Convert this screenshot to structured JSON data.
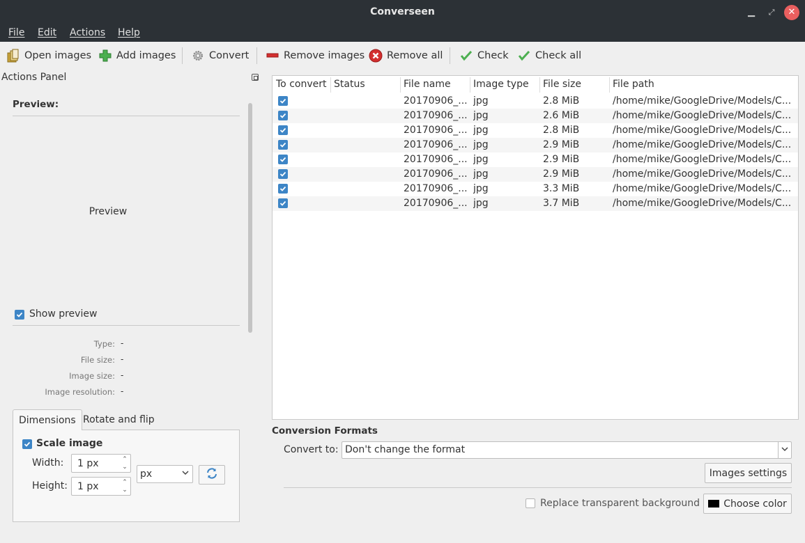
{
  "window": {
    "title": "Converseen"
  },
  "menu": [
    "File",
    "Edit",
    "Actions",
    "Help"
  ],
  "toolbar": {
    "open_images": "Open images",
    "add_images": "Add images",
    "convert": "Convert",
    "remove_images": "Remove images",
    "remove_all": "Remove all",
    "check": "Check",
    "check_all": "Check all"
  },
  "actions_panel": {
    "title": "Actions Panel",
    "preview_heading": "Preview:",
    "preview_placeholder": "Preview",
    "show_preview": {
      "label": "Show preview",
      "checked": true
    },
    "info": {
      "type_label": "Type:",
      "type_value": "-",
      "file_size_label": "File size:",
      "file_size_value": "-",
      "image_size_label": "Image size:",
      "image_size_value": "-",
      "resolution_label": "Image resolution:",
      "resolution_value": "-"
    },
    "tabs": [
      "Dimensions",
      "Rotate and flip"
    ],
    "dimensions": {
      "scale_image": {
        "label": "Scale image",
        "checked": true
      },
      "width_label": "Width:",
      "width_value": "1 px",
      "height_label": "Height:",
      "height_value": "1 px",
      "unit": "px"
    }
  },
  "table": {
    "columns": [
      "To convert",
      "Status",
      "File name",
      "Image type",
      "File size",
      "File path"
    ],
    "rows": [
      {
        "checked": true,
        "status": "",
        "file_name": "20170906_...",
        "type": "jpg",
        "size": "2.8 MiB",
        "path": "/home/mike/GoogleDrive/Models/C..."
      },
      {
        "checked": true,
        "status": "",
        "file_name": "20170906_...",
        "type": "jpg",
        "size": "2.6 MiB",
        "path": "/home/mike/GoogleDrive/Models/C..."
      },
      {
        "checked": true,
        "status": "",
        "file_name": "20170906_...",
        "type": "jpg",
        "size": "2.8 MiB",
        "path": "/home/mike/GoogleDrive/Models/C..."
      },
      {
        "checked": true,
        "status": "",
        "file_name": "20170906_...",
        "type": "jpg",
        "size": "2.9 MiB",
        "path": "/home/mike/GoogleDrive/Models/C..."
      },
      {
        "checked": true,
        "status": "",
        "file_name": "20170906_...",
        "type": "jpg",
        "size": "2.9 MiB",
        "path": "/home/mike/GoogleDrive/Models/C..."
      },
      {
        "checked": true,
        "status": "",
        "file_name": "20170906_...",
        "type": "jpg",
        "size": "2.9 MiB",
        "path": "/home/mike/GoogleDrive/Models/C..."
      },
      {
        "checked": true,
        "status": "",
        "file_name": "20170906_...",
        "type": "jpg",
        "size": "3.3 MiB",
        "path": "/home/mike/GoogleDrive/Models/C..."
      },
      {
        "checked": true,
        "status": "",
        "file_name": "20170906_...",
        "type": "jpg",
        "size": "3.7 MiB",
        "path": "/home/mike/GoogleDrive/Models/C..."
      }
    ]
  },
  "conversion": {
    "title": "Conversion Formats",
    "convert_to_label": "Convert to:",
    "convert_to_value": "Don't change the format",
    "images_settings": "Images settings",
    "replace_transparent": {
      "label": "Replace transparent background",
      "checked": false
    },
    "choose_color": "Choose color",
    "background_color": "#000000"
  },
  "colors": {
    "accent": "#3d85c6",
    "titlebar": "#2c3136",
    "close": "#e95f5f",
    "add": "#4caf50",
    "remove": "#d32f2f",
    "check": "#4caf50"
  }
}
